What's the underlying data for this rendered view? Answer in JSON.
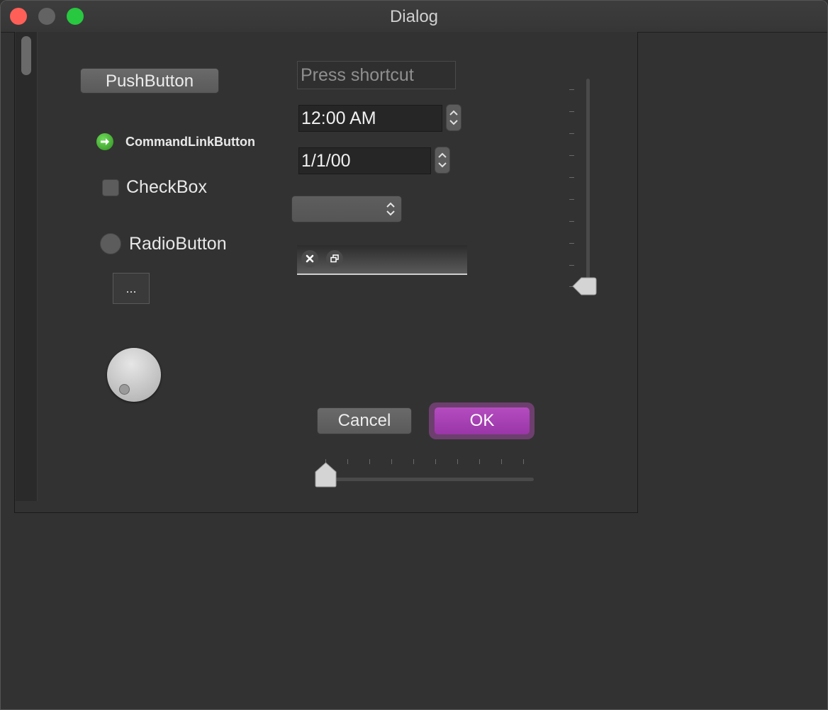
{
  "window": {
    "title": "Dialog"
  },
  "widgets": {
    "push_button_label": "PushButton",
    "command_link_label": "CommandLinkButton",
    "checkbox_label": "CheckBox",
    "checkbox_checked": false,
    "radio_label": "RadioButton",
    "radio_checked": false,
    "tool_button_label": "...",
    "key_sequence_placeholder": "Press shortcut",
    "time_value": "12:00 AM",
    "date_value": "1/1/00",
    "combobox_value": "",
    "vertical_slider_value": 0,
    "horizontal_slider_value": 0
  },
  "buttons": {
    "cancel_label": "Cancel",
    "ok_label": "OK"
  },
  "colors": {
    "accent": "#a040b0",
    "close": "#ff5f57",
    "minimize": "#636363",
    "maximize": "#28c840",
    "command_link_icon": "#3aa52a"
  },
  "icons": {
    "command_link": "arrow-right-icon",
    "mdi_close": "close-icon",
    "mdi_restore": "restore-icon"
  }
}
